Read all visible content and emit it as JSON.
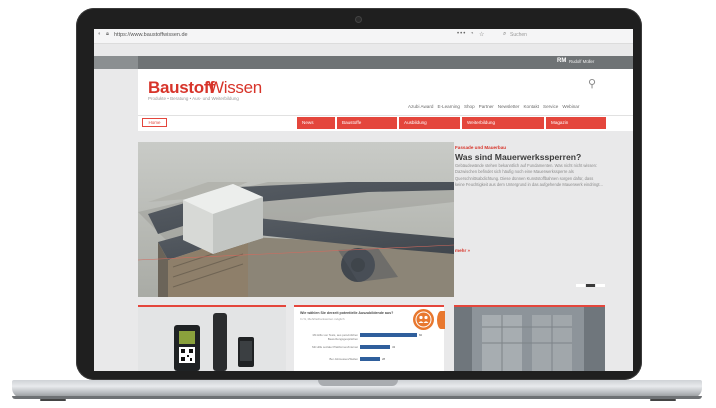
{
  "browser": {
    "url": "https://www.baustoffwissen.de",
    "menu_dots": "•••",
    "search_placeholder": "Suchen"
  },
  "site": {
    "logo_part1": "Baustoff",
    "logo_part2": "Wissen",
    "tagline": "Produkte • Beratung • Aus- und Weiterbildung",
    "user": {
      "initials": "RM",
      "name": "Rudolf Müller"
    },
    "util_nav": [
      "Azubi Award",
      "E-Learning",
      "Shop",
      "Partner",
      "Newsletter",
      "Kontakt",
      "Service",
      "Webinar"
    ],
    "main_nav": {
      "home": "Home",
      "items": [
        "News",
        "Baustoffe",
        "Ausbildung",
        "Weiterbildung",
        "Magazin"
      ]
    }
  },
  "hero": {
    "kicker": "Fassade und Mauerbau",
    "title": "Was sind Mauerwerkssperren?",
    "body": "Gebäudewände stehen bekanntlich auf Fundamenten. Was nicht nicht wissen: Dazwischen befindet sich häufig noch eine Mauerwerkssperre als Querschnittsabdichtung. Diese dünnen Kunststoffbahnen sorgen dafür, dass keine Feuchtigkeit aus dem Untergrund in das aufgehende Mauerwerk eindringt...",
    "more": "mehr »",
    "slides": 3,
    "active_slide": 2
  },
  "poll": {
    "question": "Wie wählen Sie derzeit potentielle Auszubildende aus?",
    "subtitle": "In %, Mehrfachantworten möglich",
    "bars": [
      {
        "label": "Mit Hilfe von Tests, aus persönlichen Bewerbungsgesprächen",
        "value": 82
      },
      {
        "label": "Mit Hilfe sozialer Plattformen/Internet",
        "value": 43
      },
      {
        "label": "Bei Jobmessen/Stellen",
        "value": 28
      }
    ]
  },
  "colors": {
    "accent": "#e4463c",
    "logo": "#d7342a",
    "poll_bar": "#2f5f9c",
    "badge": "#e8782f"
  }
}
